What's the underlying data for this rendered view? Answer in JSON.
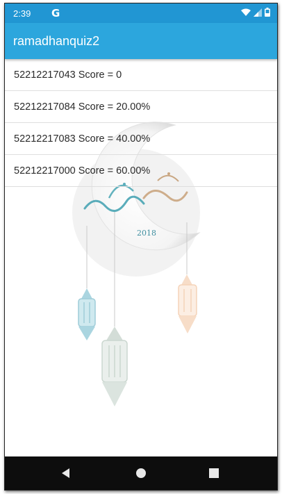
{
  "status_bar": {
    "time": "2:39",
    "g_icon": "G",
    "icons": [
      "wifi-icon",
      "signal-icon",
      "battery-icon"
    ]
  },
  "app_bar": {
    "title": "ramadhanquiz2"
  },
  "scores": [
    {
      "text": "52212217043 Score = 0"
    },
    {
      "text": "52212217084 Score = 20.00%"
    },
    {
      "text": "52212217083 Score = 40.00%"
    },
    {
      "text": "52212217000 Score = 60.00%"
    }
  ],
  "background": {
    "year": "2018",
    "icons": [
      "crescent-moon-icon",
      "lantern-icon"
    ]
  },
  "nav_bar": {
    "icons": [
      "back-icon",
      "home-icon",
      "recents-icon"
    ]
  },
  "colors": {
    "status_bar": "#2196d3",
    "app_bar": "#2ca6dd",
    "nav_bar": "#0d0d0d",
    "text": "#2a2a2a"
  }
}
